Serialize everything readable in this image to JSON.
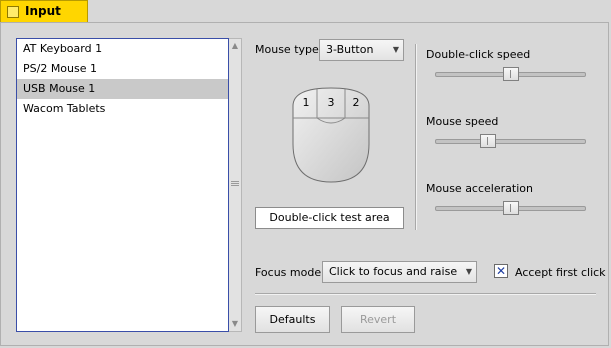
{
  "window": {
    "title": "Input"
  },
  "devices": {
    "items": [
      "AT Keyboard 1",
      "PS/2 Mouse 1",
      "USB Mouse 1",
      "Wacom Tablets"
    ],
    "selected": "USB Mouse 1"
  },
  "mouse": {
    "type_label": "Mouse type:",
    "type_value": "3-Button",
    "buttons": [
      "1",
      "3",
      "2"
    ],
    "test_area": "Double-click test area"
  },
  "sliders": {
    "double_click_label": "Double-click speed",
    "double_click_value": 0.5,
    "speed_label": "Mouse speed",
    "speed_value": 0.33,
    "accel_label": "Mouse acceleration",
    "accel_value": 0.5
  },
  "focus": {
    "label": "Focus mode:",
    "value": "Click to focus and raise",
    "accept_first_click_label": "Accept first click",
    "accept_first_click": true,
    "check_mark": "✕"
  },
  "buttons": {
    "defaults": "Defaults",
    "revert": "Revert"
  },
  "icons": {
    "scroll_up": "scroll-up-arrow",
    "scroll_down": "scroll-down-arrow",
    "dropdown": "chevron-down"
  }
}
